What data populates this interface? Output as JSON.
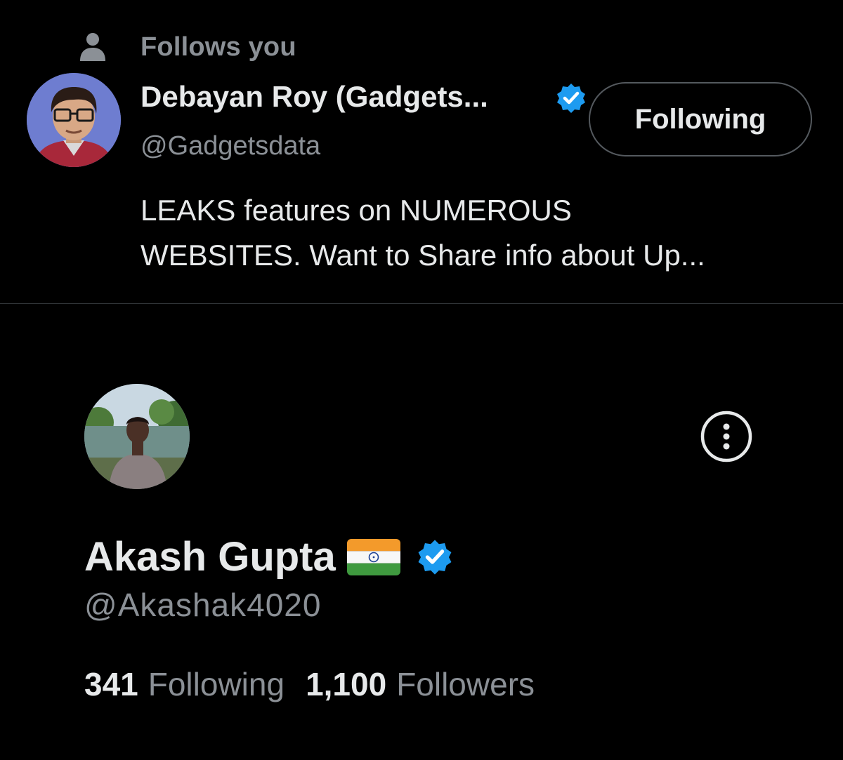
{
  "colors": {
    "background": "#000000",
    "primary_text": "#e7e9ea",
    "secondary_text": "#8b9096",
    "verified_blue": "#1d9bf0",
    "divider": "#2f3336"
  },
  "suggested_user": {
    "follow_context": "Follows you",
    "follow_context_icon": "person-icon",
    "display_name": "Debayan Roy (Gadgets...",
    "verified": true,
    "handle": "@Gadgetsdata",
    "follow_button_label": "Following",
    "bio_lines": [
      "LEAKS features on NUMEROUS",
      "WEBSITES. Want to Share info about Up..."
    ]
  },
  "profile": {
    "display_name": "Akash Gupta",
    "flag": "india-flag",
    "verified": true,
    "handle": "@Akashak4020",
    "more_icon": "more-options-icon",
    "following_count": "341",
    "following_label": "Following",
    "followers_count": "1,100",
    "followers_label": "Followers"
  }
}
